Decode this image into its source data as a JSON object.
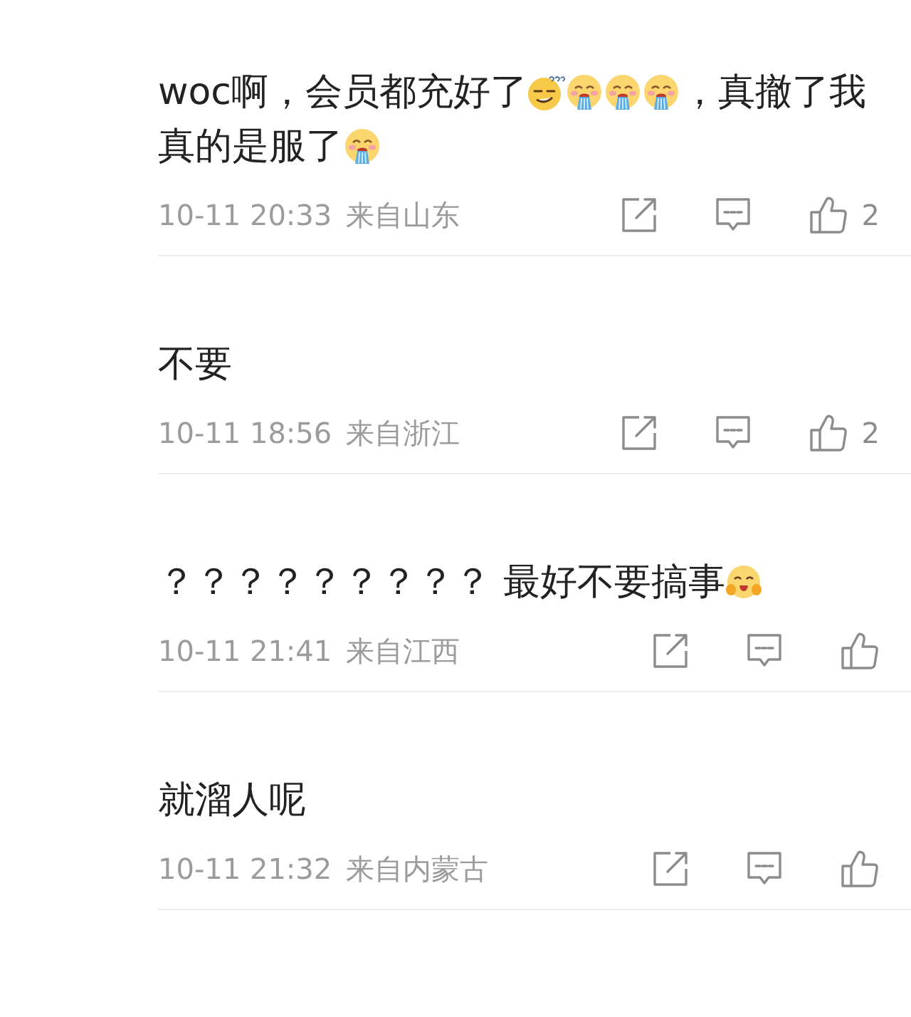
{
  "comments": [
    {
      "lines": [
        [
          {
            "kind": "text",
            "text": "woc啊，会员都充好了"
          },
          {
            "kind": "puzzled"
          },
          {
            "kind": "spew"
          },
          {
            "kind": "spew"
          },
          {
            "kind": "spew"
          },
          {
            "kind": "text",
            "text": "，真撤了我"
          }
        ],
        [
          {
            "kind": "text",
            "text": "真的是服了"
          },
          {
            "kind": "spew"
          }
        ]
      ],
      "time": "10-11 20:33",
      "location": "来自山东",
      "likes": "2"
    },
    {
      "lines": [
        [
          {
            "kind": "text",
            "text": "不要"
          }
        ]
      ],
      "time": "10-11 18:56",
      "location": "来自浙江",
      "likes": "2"
    },
    {
      "lines": [
        [
          {
            "kind": "text",
            "text": "？？？？？？？？？ 最好不要搞事"
          },
          {
            "kind": "blush"
          }
        ]
      ],
      "time": "10-11 21:41",
      "location": "来自江西"
    },
    {
      "lines": [
        [
          {
            "kind": "text",
            "text": "就溜人呢"
          }
        ]
      ],
      "time": "10-11 21:32",
      "location": "来自内蒙古"
    }
  ]
}
